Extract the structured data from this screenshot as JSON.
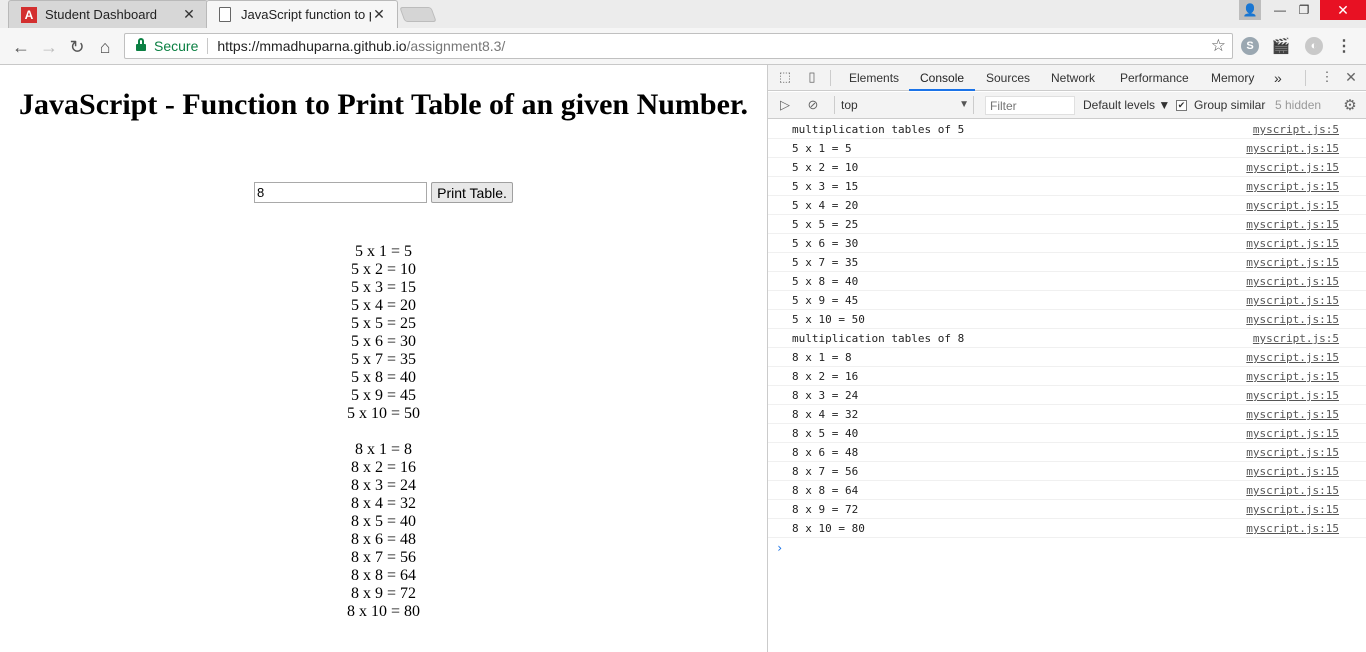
{
  "browser": {
    "tabs": [
      {
        "title": "Student Dashboard",
        "close": "✕",
        "favicon": "A"
      },
      {
        "title": "JavaScript function to prin",
        "close": "✕"
      }
    ],
    "window_controls": {
      "user": "👤",
      "minimize": "—",
      "maximize": "❐",
      "close": "✕"
    },
    "nav": {
      "back": "←",
      "forward": "→",
      "reload": "↻",
      "home": "⌂"
    },
    "omnibox": {
      "secure_label": "Secure",
      "url_host": "https://mmadhuparna.github.io",
      "url_path": "/assignment8.3/",
      "star": "☆"
    },
    "extensions": {
      "skype": "S",
      "clapper": "🎬",
      "gray": "◐"
    },
    "menu": "⋮"
  },
  "page": {
    "title": "JavaScript - Function to Print Table of an given Number.",
    "input_value": "8",
    "button_label": "Print Table.",
    "table_5": [
      "5 x 1 = 5",
      "5 x 2 = 10",
      "5 x 3 = 15",
      "5 x 4 = 20",
      "5 x 5 = 25",
      "5 x 6 = 30",
      "5 x 7 = 35",
      "5 x 8 = 40",
      "5 x 9 = 45",
      "5 x 10 = 50"
    ],
    "table_8": [
      "8 x 1 = 8",
      "8 x 2 = 16",
      "8 x 3 = 24",
      "8 x 4 = 32",
      "8 x 5 = 40",
      "8 x 6 = 48",
      "8 x 7 = 56",
      "8 x 8 = 64",
      "8 x 9 = 72",
      "8 x 10 = 80"
    ]
  },
  "devtools": {
    "tabs": [
      "Elements",
      "Console",
      "Sources",
      "Network",
      "Performance",
      "Memory"
    ],
    "active_tab": "Console",
    "more": "»",
    "kebab": "⋮",
    "close": "✕",
    "icons": {
      "inspect": "⬚",
      "device": "▯",
      "sidebar": "▷",
      "clear": "⊘",
      "settings": "⚙"
    },
    "context": "top",
    "context_arrow": "▼",
    "filter_placeholder": "Filter",
    "levels": "Default levels ▼",
    "group_similar": "Group similar",
    "check": "✔",
    "hidden_count": "5 hidden",
    "prompt": "›",
    "logs": [
      {
        "msg": "multiplication tables of 5",
        "src": "myscript.js:5"
      },
      {
        "msg": "5 x 1 = 5",
        "src": "myscript.js:15"
      },
      {
        "msg": "5 x 2 = 10",
        "src": "myscript.js:15"
      },
      {
        "msg": "5 x 3 = 15",
        "src": "myscript.js:15"
      },
      {
        "msg": "5 x 4 = 20",
        "src": "myscript.js:15"
      },
      {
        "msg": "5 x 5 = 25",
        "src": "myscript.js:15"
      },
      {
        "msg": "5 x 6 = 30",
        "src": "myscript.js:15"
      },
      {
        "msg": "5 x 7 = 35",
        "src": "myscript.js:15"
      },
      {
        "msg": "5 x 8 = 40",
        "src": "myscript.js:15"
      },
      {
        "msg": "5 x 9 = 45",
        "src": "myscript.js:15"
      },
      {
        "msg": "5 x 10 = 50",
        "src": "myscript.js:15"
      },
      {
        "msg": "multiplication tables of 8",
        "src": "myscript.js:5"
      },
      {
        "msg": "8 x 1 = 8",
        "src": "myscript.js:15"
      },
      {
        "msg": "8 x 2 = 16",
        "src": "myscript.js:15"
      },
      {
        "msg": "8 x 3 = 24",
        "src": "myscript.js:15"
      },
      {
        "msg": "8 x 4 = 32",
        "src": "myscript.js:15"
      },
      {
        "msg": "8 x 5 = 40",
        "src": "myscript.js:15"
      },
      {
        "msg": "8 x 6 = 48",
        "src": "myscript.js:15"
      },
      {
        "msg": "8 x 7 = 56",
        "src": "myscript.js:15"
      },
      {
        "msg": "8 x 8 = 64",
        "src": "myscript.js:15"
      },
      {
        "msg": "8 x 9 = 72",
        "src": "myscript.js:15"
      },
      {
        "msg": "8 x 10 = 80",
        "src": "myscript.js:15"
      }
    ]
  }
}
